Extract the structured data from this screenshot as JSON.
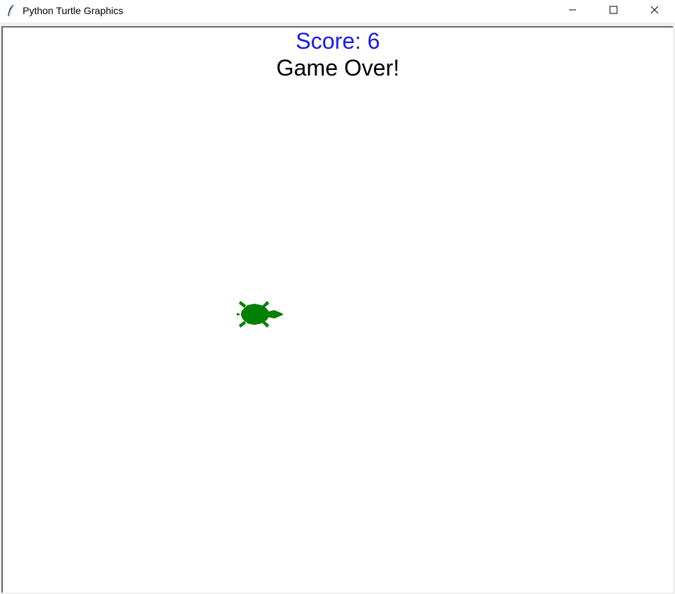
{
  "window": {
    "title": "Python Turtle Graphics",
    "app_icon": "feather-icon",
    "controls": {
      "minimize_icon": "minimize-icon",
      "maximize_icon": "maximize-icon",
      "close_icon": "close-icon"
    }
  },
  "game": {
    "score_text": "Score: 6",
    "score_color": "#1a1ae6",
    "status_text": "Game Over!",
    "status_color": "#000000",
    "turtle_color": "#008000",
    "turtle_icon": "turtle-icon"
  }
}
